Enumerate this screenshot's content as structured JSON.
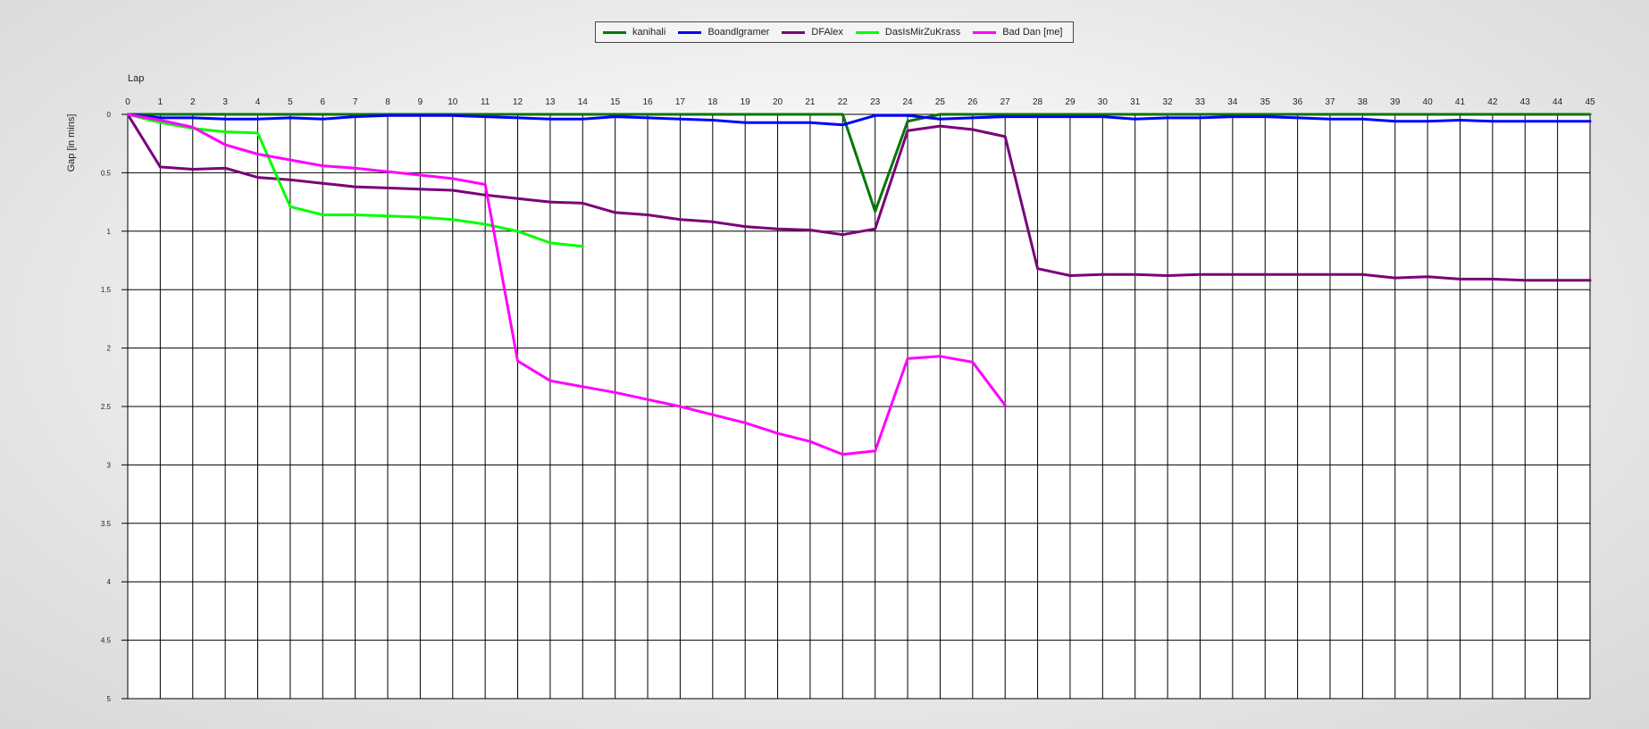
{
  "chart_data": {
    "type": "line",
    "xlabel": "Lap",
    "ylabel": "Gap [in mins]",
    "xlim": [
      0,
      45
    ],
    "ylim": [
      0,
      5
    ],
    "y_inverted": true,
    "grid": true,
    "legend_position": "top-center",
    "x_ticks": [
      "0",
      "1",
      "2",
      "3",
      "4",
      "5",
      "6",
      "7",
      "8",
      "9",
      "10",
      "11",
      "12",
      "13",
      "14",
      "15",
      "16",
      "17",
      "18",
      "19",
      "20",
      "21",
      "22",
      "23",
      "24",
      "25",
      "26",
      "27",
      "28",
      "29",
      "30",
      "31",
      "32",
      "33",
      "34",
      "35",
      "36",
      "37",
      "38",
      "39",
      "40",
      "41",
      "42",
      "43",
      "44",
      "45"
    ],
    "y_ticks": [
      "0",
      "0.5",
      "1",
      "1.5",
      "2",
      "2.5",
      "3",
      "3.5",
      "4",
      "4.5",
      "5"
    ],
    "series": [
      {
        "name": "kanihali",
        "color": "#007800",
        "x": [
          0,
          1,
          2,
          3,
          4,
          5,
          6,
          7,
          8,
          9,
          10,
          11,
          12,
          13,
          14,
          15,
          16,
          17,
          18,
          19,
          20,
          21,
          22,
          23,
          24,
          25,
          26,
          27,
          28,
          29,
          30,
          31,
          32,
          33,
          34,
          35,
          36,
          37,
          38,
          39,
          40,
          41,
          42,
          43,
          44,
          45
        ],
        "values": [
          0,
          0,
          0,
          0,
          0,
          0,
          0,
          0,
          0,
          0,
          0,
          0,
          0,
          0,
          0,
          0,
          0,
          0,
          0,
          0,
          0,
          0,
          0,
          0.83,
          0.06,
          0,
          0,
          0,
          0,
          0,
          0,
          0,
          0,
          0,
          0,
          0,
          0,
          0,
          0,
          0,
          0,
          0,
          0,
          0,
          0,
          0
        ]
      },
      {
        "name": "Boandlgramer",
        "color": "#0000ff",
        "x": [
          0,
          1,
          2,
          3,
          4,
          5,
          6,
          7,
          8,
          9,
          10,
          11,
          12,
          13,
          14,
          15,
          16,
          17,
          18,
          19,
          20,
          21,
          22,
          23,
          24,
          25,
          26,
          27,
          28,
          29,
          30,
          31,
          32,
          33,
          34,
          35,
          36,
          37,
          38,
          39,
          40,
          41,
          42,
          43,
          44,
          45
        ],
        "values": [
          0,
          0.03,
          0.03,
          0.04,
          0.04,
          0.03,
          0.04,
          0.02,
          0.01,
          0.01,
          0.01,
          0.02,
          0.03,
          0.04,
          0.04,
          0.02,
          0.03,
          0.04,
          0.05,
          0.07,
          0.07,
          0.07,
          0.09,
          0.01,
          0.01,
          0.04,
          0.03,
          0.02,
          0.02,
          0.02,
          0.02,
          0.04,
          0.03,
          0.03,
          0.02,
          0.02,
          0.03,
          0.04,
          0.04,
          0.06,
          0.06,
          0.05,
          0.06,
          0.06,
          0.06,
          0.06
        ]
      },
      {
        "name": "DFAlex",
        "color": "#7a007a",
        "x": [
          0,
          1,
          2,
          3,
          4,
          5,
          6,
          7,
          8,
          9,
          10,
          11,
          12,
          13,
          14,
          15,
          16,
          17,
          18,
          19,
          20,
          21,
          22,
          23,
          24,
          25,
          26,
          27,
          28,
          29,
          30,
          31,
          32,
          33,
          34,
          35,
          36,
          37,
          38,
          39,
          40,
          41,
          42,
          43,
          44,
          45
        ],
        "values": [
          0,
          0.45,
          0.47,
          0.46,
          0.54,
          0.56,
          0.59,
          0.62,
          0.63,
          0.64,
          0.65,
          0.69,
          0.72,
          0.75,
          0.76,
          0.84,
          0.86,
          0.9,
          0.92,
          0.96,
          0.98,
          0.99,
          1.03,
          0.98,
          0.14,
          0.1,
          0.13,
          0.19,
          1.32,
          1.38,
          1.37,
          1.37,
          1.38,
          1.37,
          1.37,
          1.37,
          1.37,
          1.37,
          1.37,
          1.4,
          1.39,
          1.41,
          1.41,
          1.42,
          1.42,
          1.42
        ]
      },
      {
        "name": "DasIsMirZuKrass",
        "color": "#00ff00",
        "x": [
          0,
          1,
          2,
          3,
          4,
          5,
          6,
          7,
          8,
          9,
          10,
          11,
          12,
          13,
          14
        ],
        "values": [
          0,
          0.07,
          0.12,
          0.15,
          0.16,
          0.79,
          0.86,
          0.86,
          0.87,
          0.88,
          0.9,
          0.94,
          1.0,
          1.1,
          1.13
        ]
      },
      {
        "name": "Bad Dan [me]",
        "color": "#ff00ff",
        "x": [
          0,
          1,
          2,
          3,
          4,
          5,
          6,
          7,
          8,
          9,
          10,
          11,
          12,
          13,
          14,
          15,
          16,
          17,
          18,
          19,
          20,
          21,
          22,
          23,
          24,
          25,
          26,
          27
        ],
        "values": [
          0,
          0.05,
          0.11,
          0.26,
          0.34,
          0.39,
          0.44,
          0.46,
          0.49,
          0.52,
          0.55,
          0.6,
          2.11,
          2.28,
          2.33,
          2.38,
          2.44,
          2.5,
          2.57,
          2.64,
          2.73,
          2.8,
          2.91,
          2.88,
          2.09,
          2.07,
          2.12,
          2.49
        ]
      }
    ]
  }
}
